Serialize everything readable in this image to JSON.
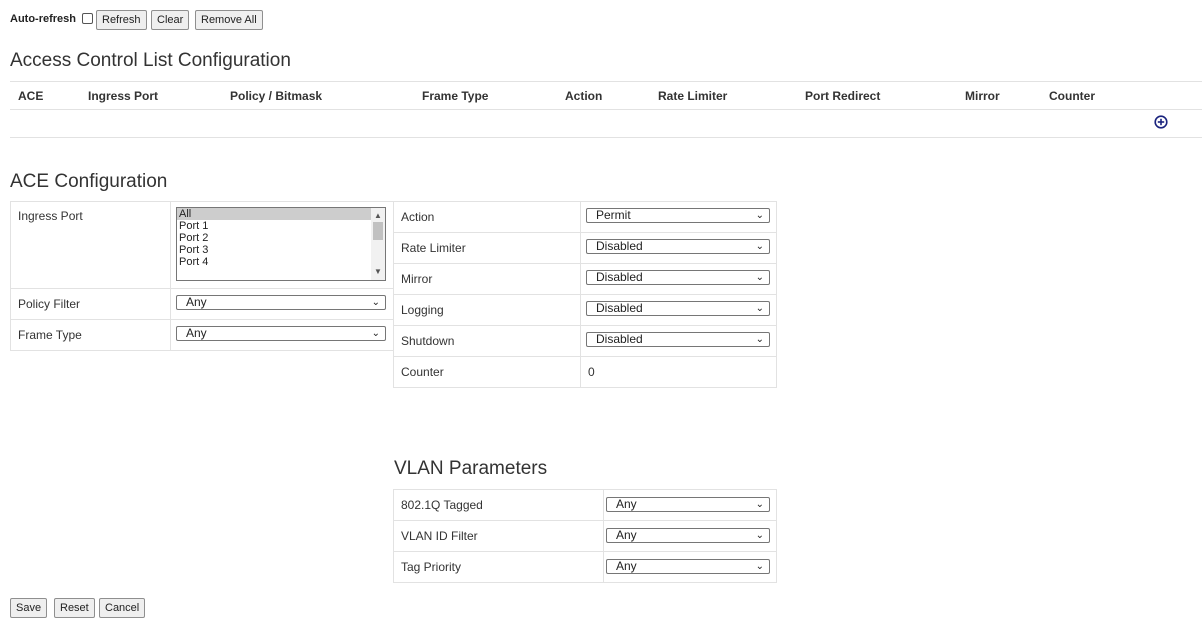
{
  "toolbar": {
    "auto_refresh_label": "Auto-refresh",
    "auto_refresh_checked": false,
    "refresh": "Refresh",
    "clear": "Clear",
    "remove_all": "Remove All"
  },
  "acl": {
    "title": "Access Control List Configuration",
    "columns": [
      "ACE",
      "Ingress Port",
      "Policy / Bitmask",
      "Frame Type",
      "Action",
      "Rate Limiter",
      "Port Redirect",
      "Mirror",
      "Counter"
    ],
    "add_icon": "plus-circle-icon"
  },
  "ace": {
    "title": "ACE Configuration",
    "ingress_port_label": "Ingress Port",
    "ingress_port_options": [
      "All",
      "Port 1",
      "Port 2",
      "Port 3",
      "Port 4"
    ],
    "ingress_port_selected": "All",
    "policy_filter_label": "Policy Filter",
    "policy_filter_value": "Any",
    "frame_type_label": "Frame Type",
    "frame_type_value": "Any",
    "action_label": "Action",
    "action_value": "Permit",
    "rate_limiter_label": "Rate Limiter",
    "rate_limiter_value": "Disabled",
    "mirror_label": "Mirror",
    "mirror_value": "Disabled",
    "logging_label": "Logging",
    "logging_value": "Disabled",
    "shutdown_label": "Shutdown",
    "shutdown_value": "Disabled",
    "counter_label": "Counter",
    "counter_value": "0"
  },
  "vlan": {
    "title": "VLAN Parameters",
    "tagged_label": "802.1Q Tagged",
    "tagged_value": "Any",
    "vid_label": "VLAN ID Filter",
    "vid_value": "Any",
    "priority_label": "Tag Priority",
    "priority_value": "Any"
  },
  "footer": {
    "save": "Save",
    "reset": "Reset",
    "cancel": "Cancel"
  },
  "colors": {
    "add_icon": "#1a237e",
    "border": "#e2e2e2"
  }
}
